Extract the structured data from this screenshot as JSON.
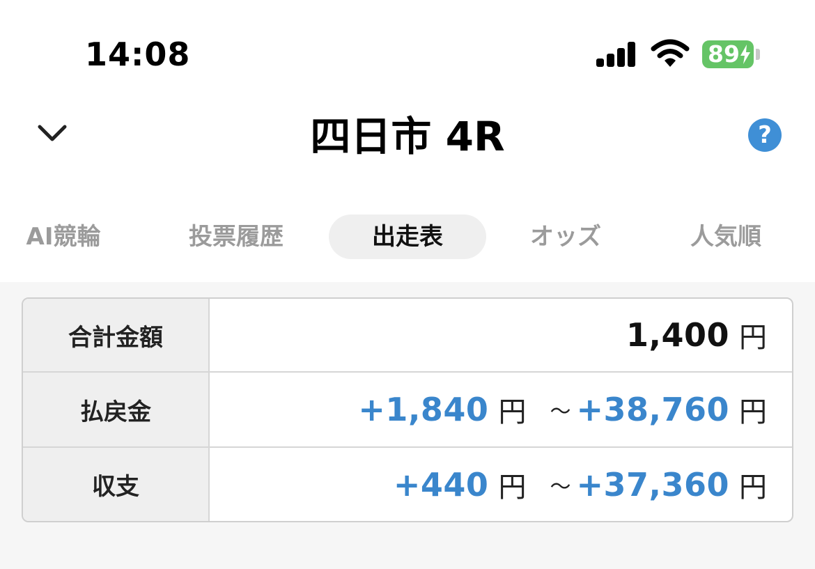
{
  "status_bar": {
    "time": "14:08",
    "battery_level": "89"
  },
  "nav": {
    "title": "四日市 4R",
    "help_label": "?"
  },
  "tabs": [
    {
      "label": "AI競輪",
      "active": false
    },
    {
      "label": "投票履歴",
      "active": false
    },
    {
      "label": "出走表",
      "active": true
    },
    {
      "label": "オッズ",
      "active": false
    },
    {
      "label": "人気順",
      "active": false
    }
  ],
  "summary": {
    "rows": [
      {
        "label": "合計金額",
        "value": "1,400",
        "unit": "円"
      },
      {
        "label": "払戻金",
        "min": "+1,840",
        "max": "+38,760",
        "unit": "円",
        "separator": "～"
      },
      {
        "label": "収支",
        "min": "+440",
        "max": "+37,360",
        "unit": "円",
        "separator": "～"
      }
    ]
  },
  "colors": {
    "accent_blue": "#3a86cc",
    "battery_green": "#65c466",
    "help_blue": "#3f8fd6"
  }
}
